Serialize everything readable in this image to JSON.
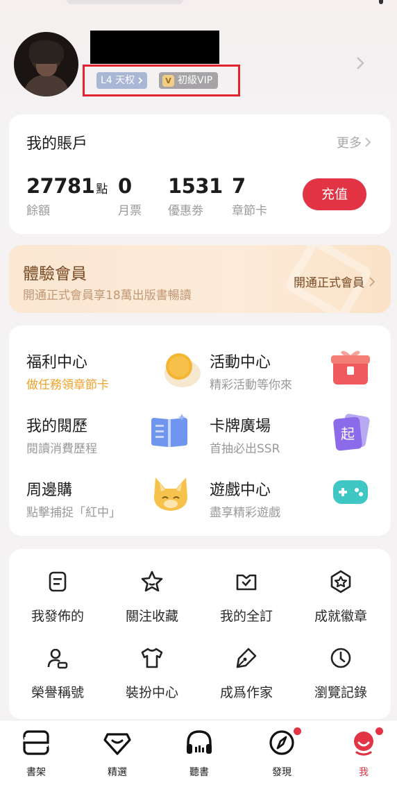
{
  "profile": {
    "level_badge": "L4 天权",
    "vip_badge": "初級VIP"
  },
  "account": {
    "title": "我的賬戶",
    "more": "更多",
    "stats": [
      {
        "value": "27781",
        "unit": "點",
        "label": "餘額"
      },
      {
        "value": "0",
        "unit": "",
        "label": "月票"
      },
      {
        "value": "1531",
        "unit": "",
        "label": "優惠劵"
      },
      {
        "value": "7",
        "unit": "",
        "label": "章節卡"
      }
    ],
    "recharge": "充值"
  },
  "trial": {
    "title": "體驗會員",
    "subtitle": "開通正式會員享18萬出版書暢讀",
    "cta": "開通正式會員"
  },
  "features": [
    {
      "title": "福利中心",
      "subtitle": "做任務領章節卡",
      "icon": "coin-icon"
    },
    {
      "title": "活動中心",
      "subtitle": "精彩活動等你來",
      "icon": "gift-box-icon"
    },
    {
      "title": "我的閱歷",
      "subtitle": "閱讀消費歷程",
      "icon": "open-book-icon"
    },
    {
      "title": "卡牌廣場",
      "subtitle": "首抽必出SSR",
      "icon": "card-icon"
    },
    {
      "title": "周邊購",
      "subtitle": "點擊捕捉「紅中」",
      "icon": "fox-mascot-icon"
    },
    {
      "title": "遊戲中心",
      "subtitle": "盡享精彩遊戲",
      "icon": "gamepad-icon"
    }
  ],
  "tools": [
    {
      "label": "我發佈的",
      "icon": "document-icon"
    },
    {
      "label": "關注收藏",
      "icon": "star-icon"
    },
    {
      "label": "我的全訂",
      "icon": "book-heart-icon"
    },
    {
      "label": "成就徽章",
      "icon": "badge-icon"
    },
    {
      "label": "榮譽稱號",
      "icon": "user-title-icon"
    },
    {
      "label": "裝扮中心",
      "icon": "tshirt-icon"
    },
    {
      "label": "成爲作家",
      "icon": "pen-icon"
    },
    {
      "label": "瀏覽記錄",
      "icon": "clock-icon"
    }
  ],
  "tabs": [
    {
      "label": "書架",
      "icon": "bookshelf-icon"
    },
    {
      "label": "精選",
      "icon": "gem-icon"
    },
    {
      "label": "聽書",
      "icon": "headphones-icon"
    },
    {
      "label": "發現",
      "icon": "compass-icon"
    },
    {
      "label": "我",
      "icon": "profile-icon"
    }
  ],
  "colors": {
    "accent": "#e23445",
    "orange_text": "#f0a32a",
    "trial_brown": "#7a4a24"
  }
}
